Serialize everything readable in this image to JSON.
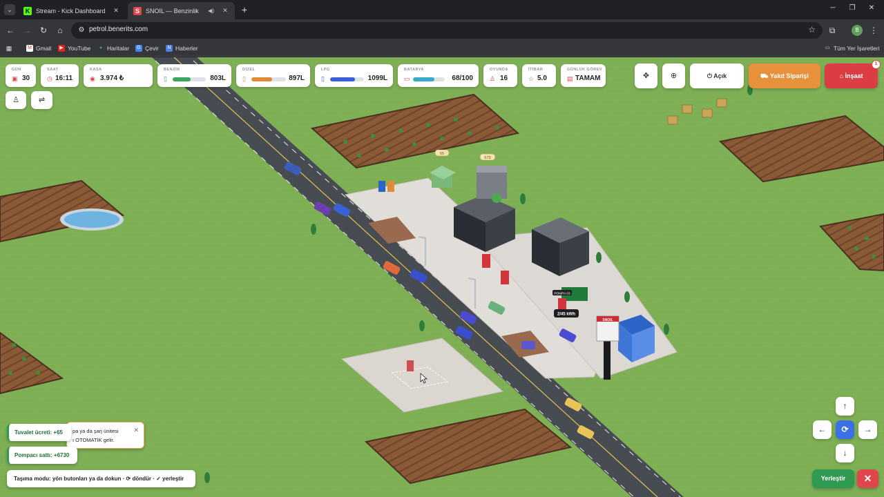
{
  "browser": {
    "tabs": [
      {
        "title": "Stream - Kick Dashboard",
        "favicon": "K",
        "active": false
      },
      {
        "title": "SNOIL — Benzinlik",
        "favicon": "S",
        "active": true
      }
    ],
    "url": "petrol.benerits.com",
    "profile_initial": "B",
    "bookmarks": [
      {
        "label": "Gmail",
        "icon": "gmail-icon"
      },
      {
        "label": "YouTube",
        "icon": "youtube-icon"
      },
      {
        "label": "Haritalar",
        "icon": "maps-icon"
      },
      {
        "label": "Çevir",
        "icon": "translate-icon"
      },
      {
        "label": "Haberler",
        "icon": "news-icon"
      }
    ],
    "all_bookmarks_label": "Tüm Yer İşaretleri"
  },
  "hud": {
    "day": {
      "label": "GÜN",
      "value": "30"
    },
    "time": {
      "label": "SAAT",
      "value": "16:11"
    },
    "cash": {
      "label": "KASA",
      "value": "3.974 ₺"
    },
    "gasoline": {
      "label": "BENZİN",
      "value": "803L",
      "level": 0.55,
      "color": "#3aa55c"
    },
    "diesel": {
      "label": "DİZEL",
      "value": "897L",
      "level": 0.6,
      "color": "#e08a3c"
    },
    "lpg": {
      "label": "LPG",
      "value": "1099L",
      "level": 0.73,
      "color": "#3d5fd6"
    },
    "battery": {
      "label": "BATARYA",
      "value": "68/100",
      "level": 0.68,
      "color": "#3aa9c7"
    },
    "players": {
      "label": "OYUNDA",
      "value": "16"
    },
    "reputation": {
      "label": "İTİBAR",
      "value": "5.0"
    },
    "daily_task": {
      "label": "GÜNLÜK GÖREV",
      "value": "TAMAM"
    }
  },
  "actions": {
    "status_label": "Açık",
    "fuel_order_label": "Yakıt Siparişi",
    "build_label": "İnşaat",
    "build_badge": "1"
  },
  "world_labels": {
    "pump_label": "POMPA 03",
    "charger_label": "2/45 kWh",
    "brand_sign": "SNOIL",
    "price_tag_1": "65",
    "price_tag_2": "673"
  },
  "notifications": {
    "toilet_fee": "Tuvalet ücreti: +65",
    "pump_sale": "Pompacı sattı: +6730",
    "info_line1": "pa ya da şarj ünitesi",
    "info_line2": "ı OTOMATİK gelir.",
    "move_mode": "Taşıma modu: yön butonları ya da dokun · ⟳ döndür · ✓ yerleştir"
  },
  "controls": {
    "place_label": "Yerleştir",
    "cancel_symbol": "✕"
  },
  "colors": {
    "grass": "#7eaf55",
    "fuel_order": "#e8913c",
    "build": "#dc3d45",
    "place": "#2e9a52",
    "rotate": "#3d6fe6"
  }
}
